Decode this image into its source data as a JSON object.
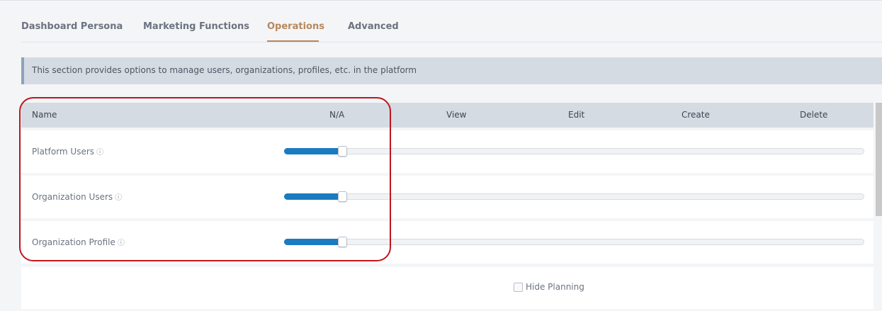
{
  "tabs": [
    {
      "label": "Dashboard Persona"
    },
    {
      "label": "Marketing Functions"
    },
    {
      "label": "Operations",
      "active": true
    },
    {
      "label": "Advanced"
    }
  ],
  "info_banner": {
    "text": "This section provides options to manage users, organizations, profiles, etc. in the platform"
  },
  "table": {
    "columns": [
      "Name",
      "N/A",
      "View",
      "Edit",
      "Create",
      "Delete"
    ],
    "rows": [
      {
        "name": "Platform Users",
        "info_icon": "ⓘ",
        "level": "N/A",
        "fill_fraction": 0.1
      },
      {
        "name": "Organization Users",
        "info_icon": "ⓘ",
        "level": "N/A",
        "fill_fraction": 0.1
      },
      {
        "name": "Organization Profile",
        "info_icon": "ⓘ",
        "level": "N/A",
        "fill_fraction": 0.1
      }
    ]
  },
  "footer": {
    "hide_planning_label": "Hide Planning",
    "hide_planning_checked": false
  },
  "colors": {
    "accent": "#b8875a",
    "slider_fill": "#1a7bc0",
    "highlight": "#c0161b"
  }
}
